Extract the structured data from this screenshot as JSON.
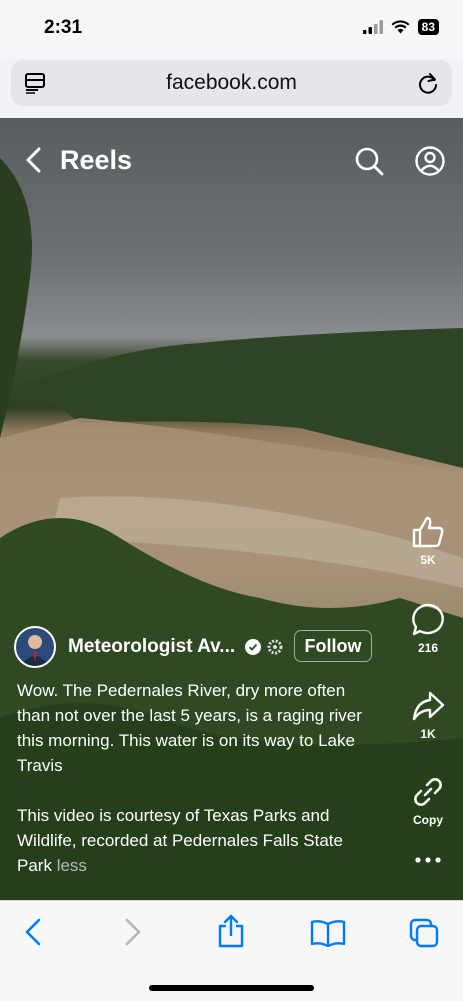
{
  "status": {
    "time": "2:31",
    "battery": "83"
  },
  "browser": {
    "url": "facebook.com"
  },
  "header": {
    "title": "Reels"
  },
  "actions": {
    "likes": "5K",
    "comments": "216",
    "shares": "1K",
    "copy": "Copy"
  },
  "author": {
    "name": "Meteorologist Av...",
    "follow": "Follow"
  },
  "caption": {
    "p1": "Wow. The Pedernales River, dry more often than not over the last 5 years, is a raging river this morning. This water is on its way to Lake Travis",
    "p2": "This video is courtesy of Texas Parks and Wildlife, recorded at Pedernales Falls State Park",
    "less": "less"
  },
  "colors": {
    "accent": "#007aff",
    "overlay_text": "#ffffff"
  }
}
